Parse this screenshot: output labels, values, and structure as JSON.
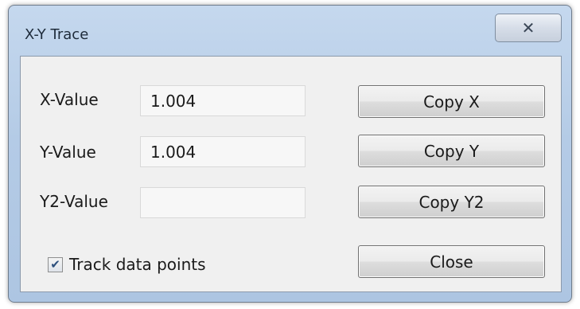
{
  "window": {
    "title": "X-Y Trace",
    "close_glyph": "✕"
  },
  "fields": [
    {
      "label": "X-Value",
      "value": "1.004"
    },
    {
      "label": "Y-Value",
      "value": "1.004"
    },
    {
      "label": "Y2-Value",
      "value": ""
    }
  ],
  "buttons": {
    "copy_x": "Copy X",
    "copy_y": "Copy Y",
    "copy_y2": "Copy Y2",
    "close": "Close"
  },
  "track": {
    "label": "Track data points",
    "checked": true,
    "check_glyph": "✔"
  }
}
